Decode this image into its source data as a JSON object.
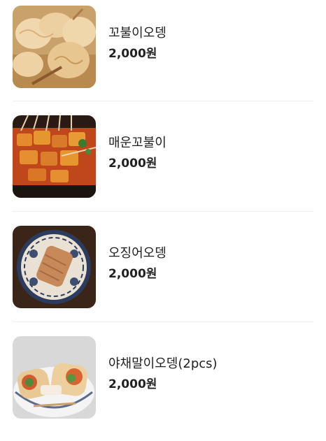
{
  "menu": {
    "items": [
      {
        "name": "꼬불이오뎅",
        "price": "2,000원",
        "image": "skewered-fishcake-photo"
      },
      {
        "name": "매운꼬불이",
        "price": "2,000원",
        "image": "spicy-fishcake-skewers-photo"
      },
      {
        "name": "오징어오뎅",
        "price": "2,000원",
        "image": "squid-fishcake-on-plate-photo"
      },
      {
        "name": "야채말이오뎅(2pcs)",
        "price": "2,000원",
        "image": "vegetable-rolled-fishcake-photo"
      }
    ]
  }
}
